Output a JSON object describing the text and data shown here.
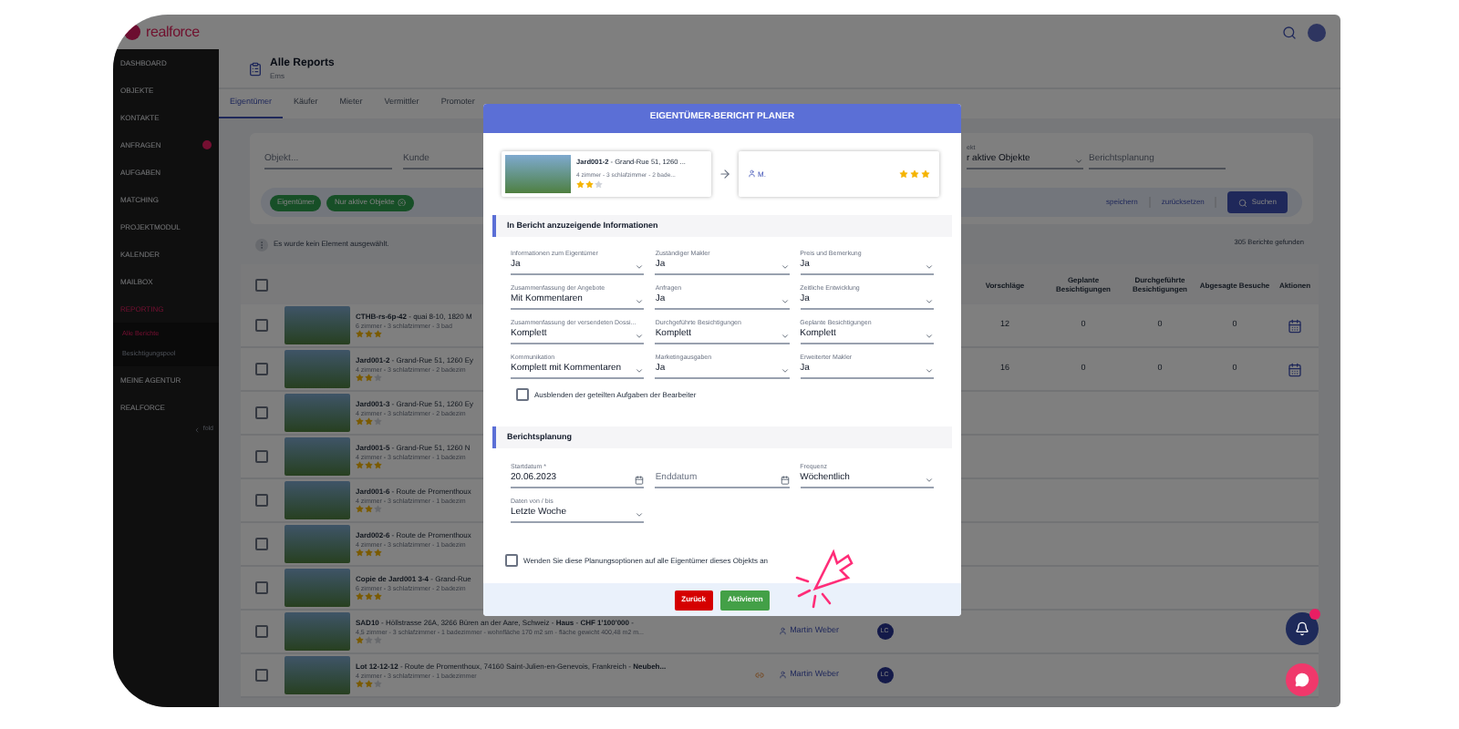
{
  "top_bar": {
    "logo": "realforce"
  },
  "sidebar": {
    "items": [
      {
        "label": "DASHBOARD",
        "selected": false
      },
      {
        "label": "OBJEKTE",
        "selected": false
      },
      {
        "label": "KONTAKTE",
        "selected": false
      },
      {
        "label": "ANFRAGEN",
        "selected": false,
        "badge": true
      },
      {
        "label": "AUFGABEN",
        "selected": false
      },
      {
        "label": "MATCHING",
        "selected": false
      },
      {
        "label": "PROJEKTMODUL",
        "selected": false
      },
      {
        "label": "KALENDER",
        "selected": false
      },
      {
        "label": "MAILBOX",
        "selected": false
      },
      {
        "label": "REPORTING",
        "selected": true,
        "children": [
          {
            "label": "Alle Berichte",
            "selected": true
          },
          {
            "label": "Besichtigungspool",
            "selected": false
          }
        ]
      },
      {
        "label": "MEINE AGENTUR",
        "selected": false
      },
      {
        "label": "REALFORCE",
        "selected": false
      }
    ],
    "fold": "fold"
  },
  "page": {
    "title": "Alle Reports",
    "subtitle": "Ems"
  },
  "tabs": [
    {
      "label": "Eigentümer",
      "selected": true
    },
    {
      "label": "Käufer",
      "selected": false
    },
    {
      "label": "Mieter",
      "selected": false
    },
    {
      "label": "Vermittler",
      "selected": false
    },
    {
      "label": "Promoter",
      "selected": false
    }
  ],
  "filters": {
    "fields_left": [
      {
        "placeholder": "Objekt..."
      },
      {
        "placeholder": "Kunde"
      }
    ],
    "fields_right": [
      {
        "label": "ekt",
        "value": "r aktive Objekte"
      },
      {
        "placeholder": "Berichtsplanung"
      }
    ],
    "chips": [
      {
        "label": "Eigentümer",
        "removable": false
      },
      {
        "label": "Nur aktive Objekte",
        "removable": true
      }
    ],
    "buttons": [
      {
        "label": "speichern",
        "kind": "link"
      },
      {
        "label": "zurücksetzen",
        "kind": "link"
      },
      {
        "label": "Suchen",
        "kind": "primary"
      }
    ]
  },
  "selection_info": "Es wurde kein Element ausgewählt.",
  "result_count": "305 Berichte gefunden",
  "table": {
    "select_all_checked": false,
    "columns": [
      "Vorschläge",
      "Geplante Besichtigungen",
      "Durchgeführte Besichtigungen",
      "Abgesagte Besuche",
      "Aktionen"
    ],
    "rows": [
      {
        "checked": false,
        "title": "**CTHB-rs-6p-42** - quai 8-10, 1820 M",
        "details": "6 zimmer - 3 schlafzimmer - 3 bad",
        "stars": 3,
        "stats": [
          "12",
          "0",
          "0",
          "0"
        ]
      },
      {
        "checked": false,
        "title": "**Jard001-2** - Grand-Rue 51, 1260 Ey",
        "details": "4 zimmer - 3 schlafzimmer - 2 badezim",
        "stars": 2,
        "stats": [
          "16",
          "0",
          "0",
          "0"
        ]
      },
      {
        "checked": false,
        "title": "**Jard001-3** - Grand-Rue 51, 1260 Ey",
        "details": "4 zimmer - 3 schlafzimmer - 2 badezim",
        "stars": 2
      },
      {
        "checked": false,
        "title": "**Jard001-5** - Grand-Rue 51, 1260 N",
        "details": "4 zimmer - 3 schlafzimmer - 1 badezim",
        "stars": 3
      },
      {
        "checked": false,
        "title": "**Jard001-6** - Route de Promenthoux",
        "details": "4 zimmer - 3 schlafzimmer - 1 badezim",
        "stars": 2
      },
      {
        "checked": false,
        "title": "**Jard002-6** - Route de Promenthoux",
        "details": "4 zimmer - 3 schlafzimmer - 1 badezim",
        "stars": 3
      },
      {
        "checked": false,
        "title": "**Copie de Jard001 3-4** - Grand-Rue",
        "details": "6 zimmer - 3 schlafzimmer - 2 badezim",
        "stars": 3
      },
      {
        "checked": false,
        "title": "**SAD10** - Höllstrasse 26A, 3266 Büren an der Aare, Schweiz - **Haus** - **CHF 1'100'000** -",
        "details": "4,5 zimmer - 3 schlafzimmer - 1 badezimmer - wohnfläche 170 m2 sm - fläche gewicht 400,48 m2 m...",
        "stars": 1,
        "agent": "Martin Weber",
        "agency": "LC",
        "flagged": false
      },
      {
        "checked": false,
        "title": "**Lot 12-12-12** - Route de Promenthoux, 74160 Saint-Julien-en-Genevois, Frankreich - **Neubeh...**",
        "details": "4 zimmer - 3 schlafzimmer - 1 badezimmer",
        "stars": 2,
        "agent": "Martin Weber",
        "agency": "LC",
        "flagged": true
      }
    ]
  },
  "modal": {
    "title": "EIGENTÜMER-BERICHT PLANER",
    "property": {
      "title": "**Jard001-2** - Grand-Rue 51, 1260 ...",
      "details": "4 zimmer - 3 schlafzimmer - 2 bade...",
      "stars": 2
    },
    "owner": {
      "name": "M.",
      "stars": 3
    },
    "sections": [
      {
        "title": "In Bericht anzuzeigende Informationen",
        "fields": [
          {
            "label": "Informationen zum Eigentümer",
            "value": "Ja",
            "kind": "select"
          },
          {
            "label": "Zuständiger Makler",
            "value": "Ja",
            "kind": "select"
          },
          {
            "label": "Preis und Bemerkung",
            "value": "Ja",
            "kind": "select"
          },
          {
            "label": "Zusammenfassung der Angebote",
            "value": "Mit Kommentaren",
            "kind": "select"
          },
          {
            "label": "Anfragen",
            "value": "Ja",
            "kind": "select"
          },
          {
            "label": "Zeitliche Entwicklung",
            "value": "Ja",
            "kind": "select"
          },
          {
            "label": "Zusammenfassung der versendeten Dossi...",
            "value": "Komplett",
            "kind": "select"
          },
          {
            "label": "Durchgeführte Besichtigungen",
            "value": "Komplett",
            "kind": "select"
          },
          {
            "label": "Geplante Besichtigungen",
            "value": "Komplett",
            "kind": "select"
          },
          {
            "label": "Kommunikation",
            "value": "Komplett mit Kommentaren",
            "kind": "select"
          },
          {
            "label": "Marketingausgaben",
            "value": "Ja",
            "kind": "select"
          },
          {
            "label": "Erweiterter Makler",
            "value": "Ja",
            "kind": "select"
          }
        ],
        "checkbox": {
          "label": "Ausblenden der geteilten Aufgaben der Bearbeiter",
          "checked": false
        }
      },
      {
        "title": "Berichtsplanung",
        "fields": [
          {
            "label": "Startdatum *",
            "value": "20.06.2023",
            "kind": "date"
          },
          {
            "placeholder": "Enddatum",
            "kind": "date"
          },
          {
            "label": "Frequenz",
            "value": "Wöchentlich",
            "kind": "select"
          },
          {
            "label": "Daten von / bis",
            "value": "Letzte Woche",
            "kind": "select"
          }
        ],
        "checkbox": {
          "label": "Wenden Sie diese Planungsoptionen auf alle Eigentümer dieses Objekts an",
          "checked": false
        }
      }
    ],
    "buttons": [
      {
        "label": "Zurück",
        "kind": "cancel"
      },
      {
        "label": "Aktivieren",
        "kind": "confirm"
      }
    ]
  }
}
